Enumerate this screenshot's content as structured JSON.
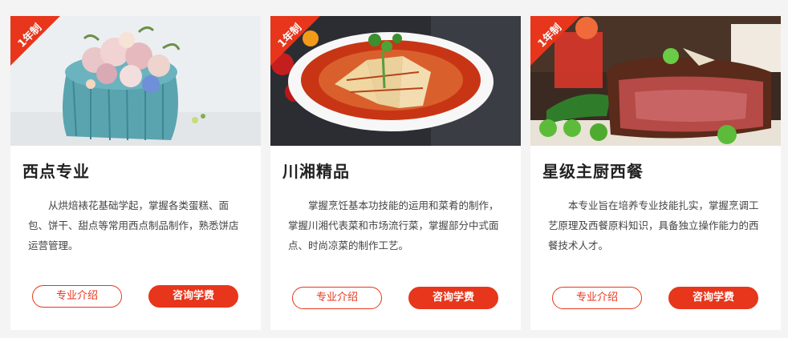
{
  "badge_label": "1年制",
  "courses": [
    {
      "title": "西点专业",
      "description": "从烘焙裱花基础学起，掌握各类蛋糕、面包、饼干、甜点等常用西点制品制作，熟悉饼店运营管理。",
      "intro_button": "专业介绍",
      "consult_button": "咨询学费"
    },
    {
      "title": "川湘精品",
      "description": "掌握烹饪基本功技能的运用和菜肴的制作，掌握川湘代表菜和市场流行菜，掌握部分中式面点、时尚凉菜的制作工艺。",
      "intro_button": "专业介绍",
      "consult_button": "咨询学费"
    },
    {
      "title": "星级主厨西餐",
      "description": "本专业旨在培养专业技能扎实，掌握烹调工艺原理及西餐原料知识，具备独立操作能力的西餐技术人才。",
      "intro_button": "专业介绍",
      "consult_button": "咨询学费"
    }
  ],
  "colors": {
    "accent": "#e7361b",
    "background": "#f4f4f4",
    "card": "#ffffff"
  }
}
